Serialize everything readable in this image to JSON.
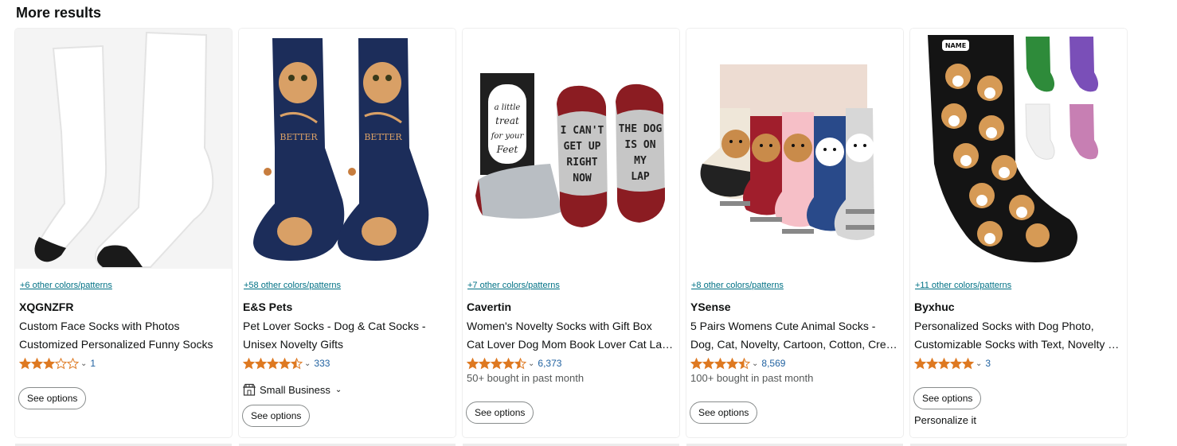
{
  "heading": "More results",
  "products": [
    {
      "colors": "+6 other colors/patterns",
      "brand": "XQGNZFR",
      "title_line1": "Custom Face Socks with Photos",
      "title_line2": "Customized Personalized Funny Socks",
      "rating": 3,
      "review_count": "1",
      "bought": "",
      "small_business": "",
      "button": "See options",
      "personalize": ""
    },
    {
      "colors": "+58 other colors/patterns",
      "brand": "E&S Pets",
      "title_line1": "Pet Lover Socks - Dog & Cat Socks -",
      "title_line2": "Unisex Novelty Gifts",
      "rating": 4.5,
      "review_count": "333",
      "bought": "",
      "small_business": "Small Business",
      "button": "See options",
      "personalize": ""
    },
    {
      "colors": "+7 other colors/patterns",
      "brand": "Cavertin",
      "title_line1": "Women's Novelty Socks with Gift Box",
      "title_line2": "Cat Lover Dog Mom Book Lover Cat Lady Gifts",
      "rating": 4.5,
      "review_count": "6,373",
      "bought": "50+ bought in past month",
      "small_business": "",
      "button": "See options",
      "personalize": ""
    },
    {
      "colors": "+8 other colors/patterns",
      "brand": "YSense",
      "title_line1": "5 Pairs Womens Cute Animal Socks -",
      "title_line2": "Dog, Cat, Novelty, Cartoon, Cotton, Crew Socks",
      "rating": 4.5,
      "review_count": "8,569",
      "bought": "100+ bought in past month",
      "small_business": "",
      "button": "See options",
      "personalize": ""
    },
    {
      "colors": "+11 other colors/patterns",
      "brand": "Byxhuc",
      "title_line1": "Personalized Socks with Dog Photo,",
      "title_line2": "Customizable Socks with Text, Novelty Gifts",
      "rating": 5,
      "review_count": "3",
      "bought": "",
      "small_business": "",
      "button": "See options",
      "personalize": "Personalize it"
    }
  ],
  "icons": {
    "star": "star-icon",
    "chevron": "chevron-down-icon",
    "small_business": "storefront-icon"
  },
  "colors": {
    "link": "#007185",
    "star": "#de7921",
    "count": "#2162a1",
    "muted": "#565959"
  }
}
